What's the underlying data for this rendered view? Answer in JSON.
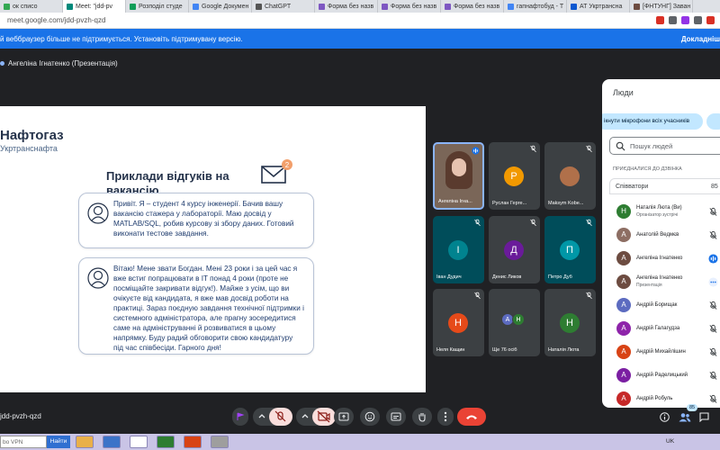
{
  "browser": {
    "tabs": [
      {
        "label": "ок списо",
        "color": "#34a853",
        "active": false
      },
      {
        "label": "Meet: \"jdd-pv",
        "color": "#00897b",
        "active": true
      },
      {
        "label": "Розподіл студе",
        "color": "#0f9d58",
        "active": false
      },
      {
        "label": "Google Докумен",
        "color": "#4285f4",
        "active": false
      },
      {
        "label": "ChatGPT",
        "color": "#555555",
        "active": false
      },
      {
        "label": "Форма без назв",
        "color": "#7e57c2",
        "active": false
      },
      {
        "label": "Форма без назв",
        "color": "#7e57c2",
        "active": false
      },
      {
        "label": "Форма без назв",
        "color": "#7e57c2",
        "active": false
      },
      {
        "label": "гапнафтобуд - Т",
        "color": "#4285f4",
        "active": false
      },
      {
        "label": "АТ Укртрансна",
        "color": "#0b57d0",
        "active": false
      },
      {
        "label": "[ФНТУНГ] Заван",
        "color": "#6d4c41",
        "active": false
      }
    ],
    "url": "meet.google.com/jdd-pvzh-qzd",
    "ext_colors": [
      "#d93025",
      "#5f6368",
      "#9334e6",
      "#5f6368",
      "#d93025"
    ]
  },
  "infobar": {
    "message": "й веббраузер більше не підтримується. Установіть підтримувану версію.",
    "link": "Докладніш"
  },
  "meeting": {
    "presenter": "Ангеліна Ігнатенко (Презентація)",
    "code": "jdd-pvzh-qzd",
    "people_count": "85"
  },
  "slide": {
    "brand": "Нафтогаз",
    "brand_sub": "Укртранснафта",
    "title": "Приклади відгуків на вакансію",
    "mail_badge": "2",
    "review1": "Привіт. Я – студент 4 курсу інженерії. Бачив вашу вакансію стажера у лабораторії. Маю досвід у MATLAB/SQL, робив курсову зі збору даних. Готовий виконати тестове завдання.",
    "review2": "Вітаю! Мене звати Богдан. Мені 23 роки і за цей час я вже встиг попрацювати в IT понад 4 роки (проте не посміщайте закривати відгук!). Майже з усім, що ви очікуєте від кандидата, я вже мав досвід роботи на практиці. Зараз поєдную завдання технічної підтримки і системного адміністратора, але прагну зосередитися саме на адмініструванні й розвиватися в цьому напрямку. Буду радий обговорити свою кандидатуру під час співбесіди. Гарного дня!"
  },
  "tiles": [
    {
      "name": "Ангеліна Ігна...",
      "letter": "",
      "bg": "#7a6658",
      "avatar": "",
      "muted": false,
      "photo": true
    },
    {
      "name": "Руслан Герге...",
      "letter": "Р",
      "bg": "#3c4043",
      "avatar": "#f29900",
      "muted": true
    },
    {
      "name": "Maksym Kobe...",
      "letter": "",
      "bg": "#3c4043",
      "avatar": "#b0704a",
      "muted": true
    },
    {
      "name": "Іван Дудич",
      "letter": "І",
      "bg": "#004d5a",
      "avatar": "#00838f",
      "muted": true
    },
    {
      "name": "Денис Ликов",
      "letter": "Д",
      "bg": "#3c4043",
      "avatar": "#6a1b9a",
      "muted": true
    },
    {
      "name": "Петро Дуб",
      "letter": "П",
      "bg": "#004d5a",
      "avatar": "#0097a7",
      "muted": true
    },
    {
      "name": "Неля Кащин",
      "letter": "Н",
      "bg": "#3c4043",
      "avatar": "#e64a19",
      "muted": true
    },
    {
      "name": "Ще 76 осіб",
      "letter": "",
      "bg": "#3c4043",
      "avatar": "",
      "muted": false
    },
    {
      "name": "Наталія Люта",
      "letter": "Н",
      "bg": "#3c4043",
      "avatar": "#2e7d32",
      "muted": true
    }
  ],
  "more_avatars": [
    "А",
    "Н"
  ],
  "people_panel": {
    "title": "Люди",
    "mute_all": "ікнути мікрофони всіх учасників",
    "search_placeholder": "Пошук людей",
    "joined_label": "ПРИЄДНАЛИСЯ ДО ДЗВІНКА",
    "cohosts_label": "Співватори",
    "cohosts_count": "85",
    "people": [
      {
        "letter": "Н",
        "color": "#2e7d32",
        "name": "Наталія Люта (Ви)",
        "role": "Організатор зустрічі",
        "icon": "mic-off"
      },
      {
        "letter": "А",
        "color": "#8d6e63",
        "name": "Анатолій Ведмєв",
        "role": "",
        "icon": "mic-off"
      },
      {
        "letter": "А",
        "color": "#6d4c41",
        "name": "Ангеліна Ігнатенко",
        "role": "",
        "icon": "speaking"
      },
      {
        "letter": "А",
        "color": "#6d4c41",
        "name": "Ангеліна Ігнатенко",
        "role": "Презентація",
        "icon": "more"
      },
      {
        "letter": "А",
        "color": "#5c6bc0",
        "name": "Андрій Борищак",
        "role": "",
        "icon": "mic-off"
      },
      {
        "letter": "А",
        "color": "#8e24aa",
        "name": "Андрій Галагудза",
        "role": "",
        "icon": "mic-off"
      },
      {
        "letter": "А",
        "color": "#d84315",
        "name": "Андрій Михайлішин",
        "role": "",
        "icon": "mic-off"
      },
      {
        "letter": "А",
        "color": "#7b1fa2",
        "name": "Андрій Раделицький",
        "role": "",
        "icon": "mic-off"
      },
      {
        "letter": "А",
        "color": "#c62828",
        "name": "Андрій Робуль",
        "role": "",
        "icon": "mic-off"
      }
    ]
  },
  "taskbar": {
    "search": "bo VPN",
    "find": "Найти",
    "lang": "UK",
    "apps": [
      "#e9b04a",
      "#3b73c8",
      "#ffffff",
      "#2e7d32",
      "#d84315",
      "#9e9e9e"
    ]
  }
}
